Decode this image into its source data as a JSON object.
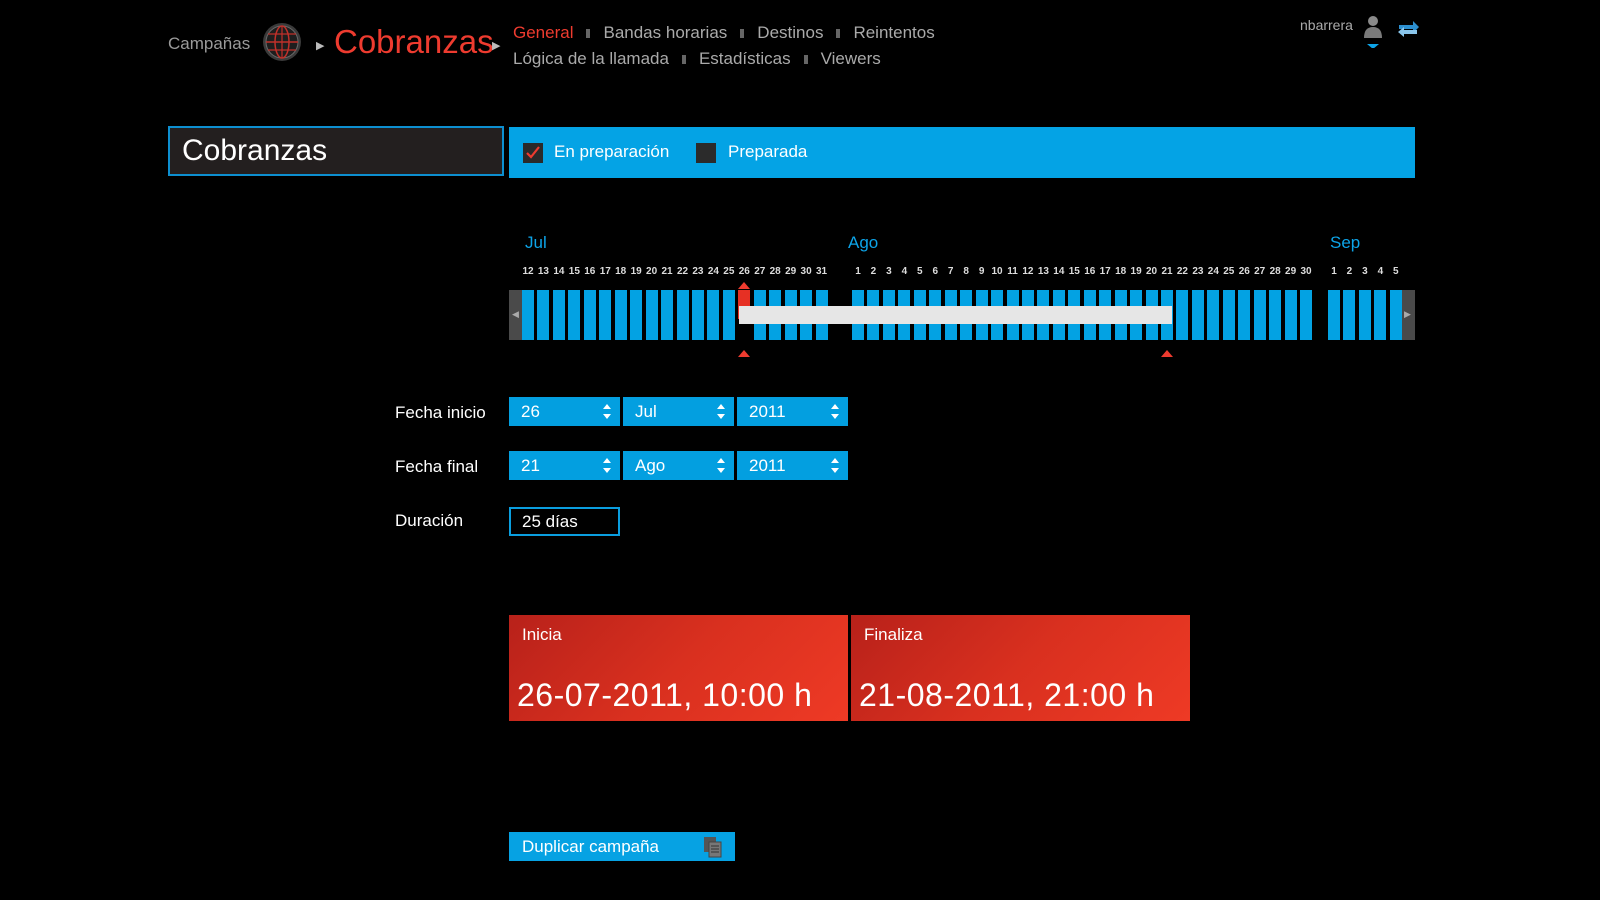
{
  "header": {
    "breadcrumb_root": "Campañas",
    "breadcrumb_current": "Cobranzas",
    "nav_row1": [
      "General",
      "Bandas horarias",
      "Destinos",
      "Reintentos"
    ],
    "nav_row2": [
      "Lógica de la llamada",
      "Estadísticas",
      "Viewers"
    ],
    "active_tab": "General",
    "username": "nbarrera"
  },
  "campaign": {
    "name": "Cobranzas",
    "status_options": [
      {
        "label": "En preparación",
        "checked": true
      },
      {
        "label": "Preparada",
        "checked": false
      }
    ]
  },
  "timeline": {
    "months": [
      "Jul",
      "Ago",
      "Sep"
    ],
    "jul_days": [
      "12",
      "13",
      "14",
      "15",
      "16",
      "17",
      "18",
      "19",
      "20",
      "21",
      "22",
      "23",
      "24",
      "25",
      "26",
      "27",
      "28",
      "29",
      "30",
      "31"
    ],
    "ago_days": [
      "1",
      "2",
      "3",
      "4",
      "5",
      "6",
      "7",
      "8",
      "9",
      "10",
      "11",
      "12",
      "13",
      "14",
      "15",
      "16",
      "17",
      "18",
      "19",
      "20",
      "21",
      "22",
      "23",
      "24",
      "25",
      "26",
      "27",
      "28",
      "29",
      "30"
    ],
    "sep_days": [
      "1",
      "2",
      "3",
      "4",
      "5"
    ],
    "range_start": "26 Jul",
    "range_end": "21 Ago"
  },
  "form": {
    "start_label": "Fecha inicio",
    "start_day": "26",
    "start_month": "Jul",
    "start_year": "2011",
    "end_label": "Fecha final",
    "end_day": "21",
    "end_month": "Ago",
    "end_year": "2011",
    "duration_label": "Duración",
    "duration_value": "25 días"
  },
  "cards": {
    "start_caption": "Inicia",
    "start_value": "26-07-2011, 10:00 h",
    "end_caption": "Finaliza",
    "end_value": "21-08-2011, 21:00 h"
  },
  "actions": {
    "duplicate_label": "Duplicar campaña"
  },
  "colors": {
    "accent_blue": "#03a2e3",
    "accent_red": "#ee3b2f",
    "background": "#000000"
  }
}
